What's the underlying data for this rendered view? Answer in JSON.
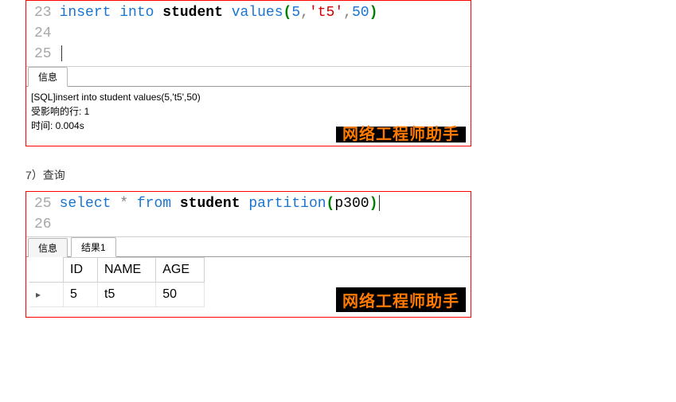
{
  "watermark": "网络工程师助手",
  "section7_label": "7）查询",
  "panel1": {
    "line_numbers": [
      "23",
      "24",
      "25"
    ],
    "code": {
      "l23": {
        "kw1": "insert",
        "kw2": "into",
        "table": "student",
        "fn": "values",
        "paren_open": "(",
        "arg_num1": "5",
        "comma1": ",",
        "arg_str": "'t5'",
        "comma2": ",",
        "arg_num2": "50",
        "paren_close": ")"
      }
    },
    "tabs": [
      {
        "label": "信息",
        "active": true
      }
    ],
    "messages": {
      "line1": "[SQL]insert into student values(5,'t5',50)",
      "line2": "受影响的行: 1",
      "line3": "时间: 0.004s"
    }
  },
  "panel2": {
    "line_numbers": [
      "25",
      "26"
    ],
    "code": {
      "l25": {
        "kw1": "select",
        "star": "*",
        "kw2": "from",
        "table": "student",
        "part_kw": "partition",
        "paren_open": "(",
        "part_name": "p300",
        "paren_close": ")"
      }
    },
    "tabs": [
      {
        "label": "信息",
        "active": false
      },
      {
        "label": "结果1",
        "active": true
      }
    ],
    "table": {
      "columns": [
        "ID",
        "NAME",
        "AGE"
      ],
      "rows": [
        {
          "ID": "5",
          "NAME": "t5",
          "AGE": "50"
        }
      ]
    }
  }
}
